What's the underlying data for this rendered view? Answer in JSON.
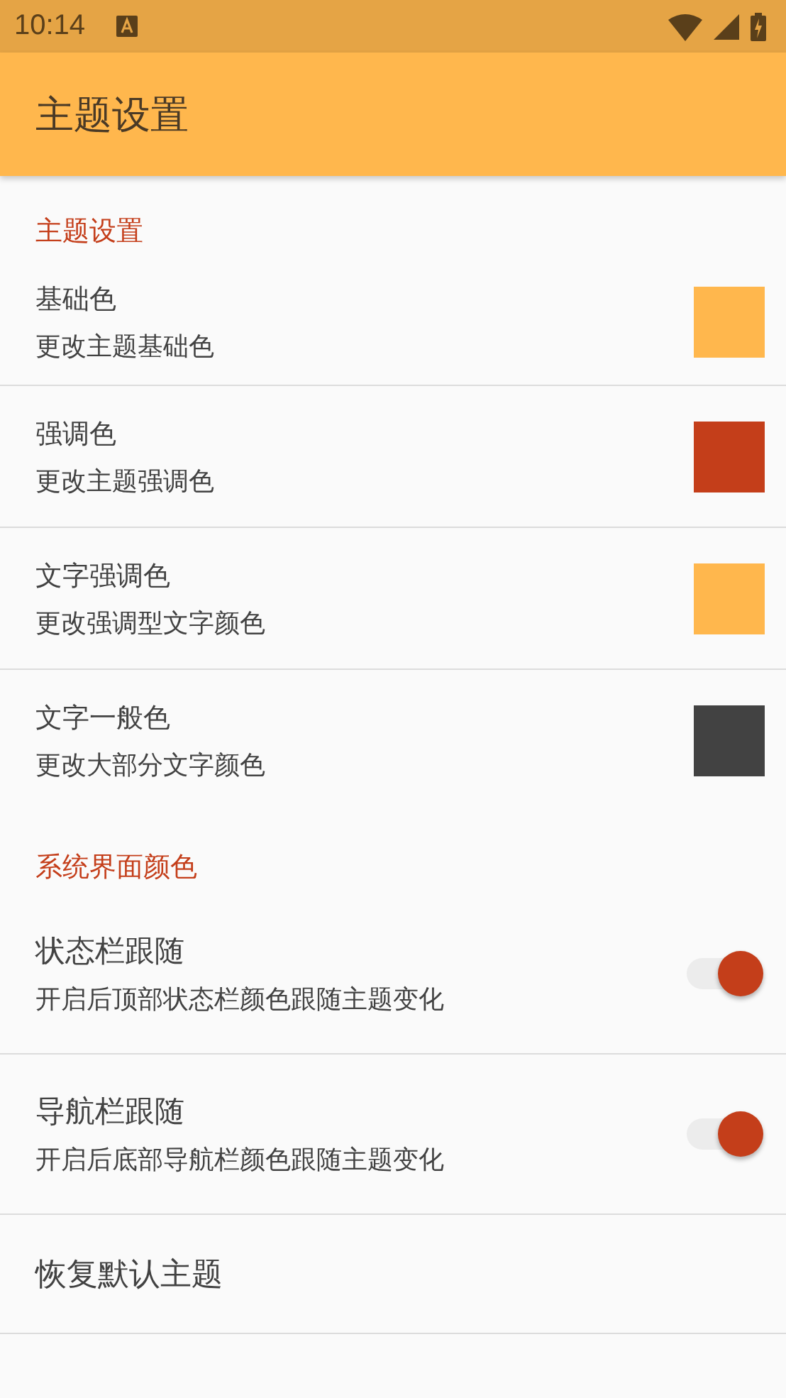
{
  "status_bar": {
    "time": "10:14"
  },
  "app_bar": {
    "title": "主题设置"
  },
  "sections": [
    {
      "header": "主题设置",
      "items": [
        {
          "kind": "color",
          "title": "基础色",
          "summary": "更改主题基础色",
          "color": "#ffb74d"
        },
        {
          "kind": "color",
          "title": "强调色",
          "summary": "更改主题强调色",
          "color": "#c43e1a"
        },
        {
          "kind": "color",
          "title": "文字强调色",
          "summary": "更改强调型文字颜色",
          "color": "#ffb74d"
        },
        {
          "kind": "color",
          "title": "文字一般色",
          "summary": "更改大部分文字颜色",
          "color": "#424242"
        }
      ]
    },
    {
      "header": "系统界面颜色",
      "items": [
        {
          "kind": "switch",
          "title": "状态栏跟随",
          "summary": "开启后顶部状态栏颜色跟随主题变化",
          "on": true
        },
        {
          "kind": "switch",
          "title": "导航栏跟随",
          "summary": "开启后底部导航栏颜色跟随主题变化",
          "on": true
        },
        {
          "kind": "action",
          "title": "恢复默认主题"
        }
      ]
    }
  ]
}
